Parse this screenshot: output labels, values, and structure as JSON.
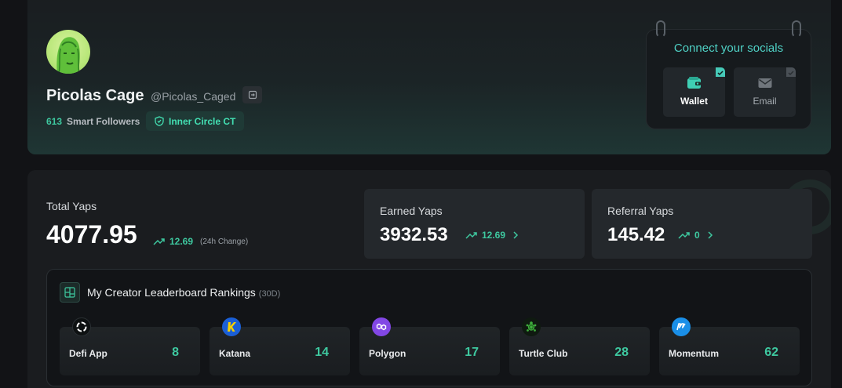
{
  "profile": {
    "name": "Picolas Cage",
    "handle": "@Picolas_Caged",
    "smart_followers_count": "613",
    "smart_followers_label": "Smart Followers",
    "badge": "Inner Circle CT"
  },
  "socials": {
    "title": "Connect your socials",
    "items": [
      {
        "label": "Wallet",
        "icon": "wallet-icon",
        "connected": true
      },
      {
        "label": "Email",
        "icon": "mail-icon",
        "connected": false
      }
    ]
  },
  "stats": {
    "total": {
      "label": "Total Yaps",
      "value": "4077.95",
      "change": "12.69",
      "change_note": "(24h Change)"
    },
    "earned": {
      "label": "Earned Yaps",
      "value": "3932.53",
      "change": "12.69"
    },
    "referral": {
      "label": "Referral Yaps",
      "value": "145.42",
      "change": "0"
    }
  },
  "rankings": {
    "title": "My Creator Leaderboard Rankings",
    "period": "(30D)",
    "items": [
      {
        "name": "Defi App",
        "rank": "8",
        "icon": "defi-app-logo"
      },
      {
        "name": "Katana",
        "rank": "14",
        "icon": "katana-logo"
      },
      {
        "name": "Polygon",
        "rank": "17",
        "icon": "polygon-logo"
      },
      {
        "name": "Turtle Club",
        "rank": "28",
        "icon": "turtle-club-logo"
      },
      {
        "name": "Momentum",
        "rank": "62",
        "icon": "momentum-logo"
      }
    ]
  },
  "colors": {
    "accent": "#3ec9a0",
    "badge_text": "#43e0b3",
    "socials_title": "#4fd1c5"
  }
}
